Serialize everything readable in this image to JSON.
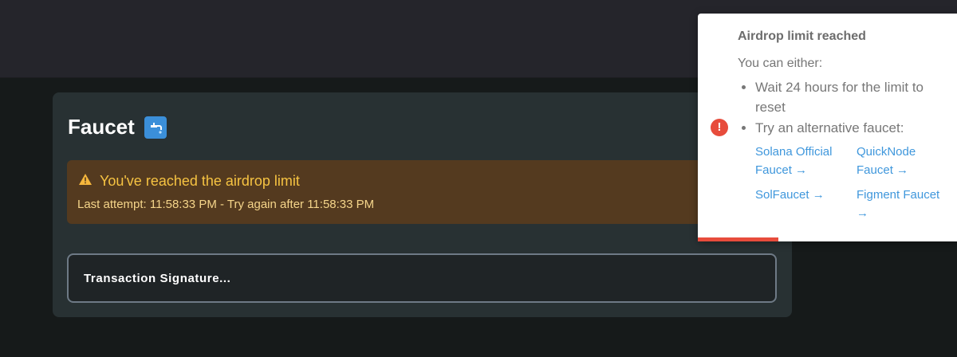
{
  "card": {
    "title": "Faucet",
    "icon": "faucet-icon",
    "alert": {
      "icon": "warning-icon",
      "heading": "You've reached the airdrop limit",
      "detail": "Last attempt: 11:58:33 PM - Try again after 11:58:33 PM"
    },
    "signature_label": "Transaction Signature..."
  },
  "toast": {
    "icon": "error-icon",
    "title": "Airdrop limit reached",
    "text": "You can either:",
    "options": [
      "Wait 24 hours for the limit to reset",
      "Try an alternative faucet:"
    ],
    "links": [
      "Solana Official Faucet →",
      "QuickNode Faucet →",
      "SolFaucet →",
      "Figment Faucet →"
    ],
    "progress_fraction": 0.31
  },
  "colors": {
    "accent_error": "#e74c3c",
    "link": "#3f97dc",
    "alert_bg": "#543a1f",
    "alert_text": "#f6c342"
  }
}
